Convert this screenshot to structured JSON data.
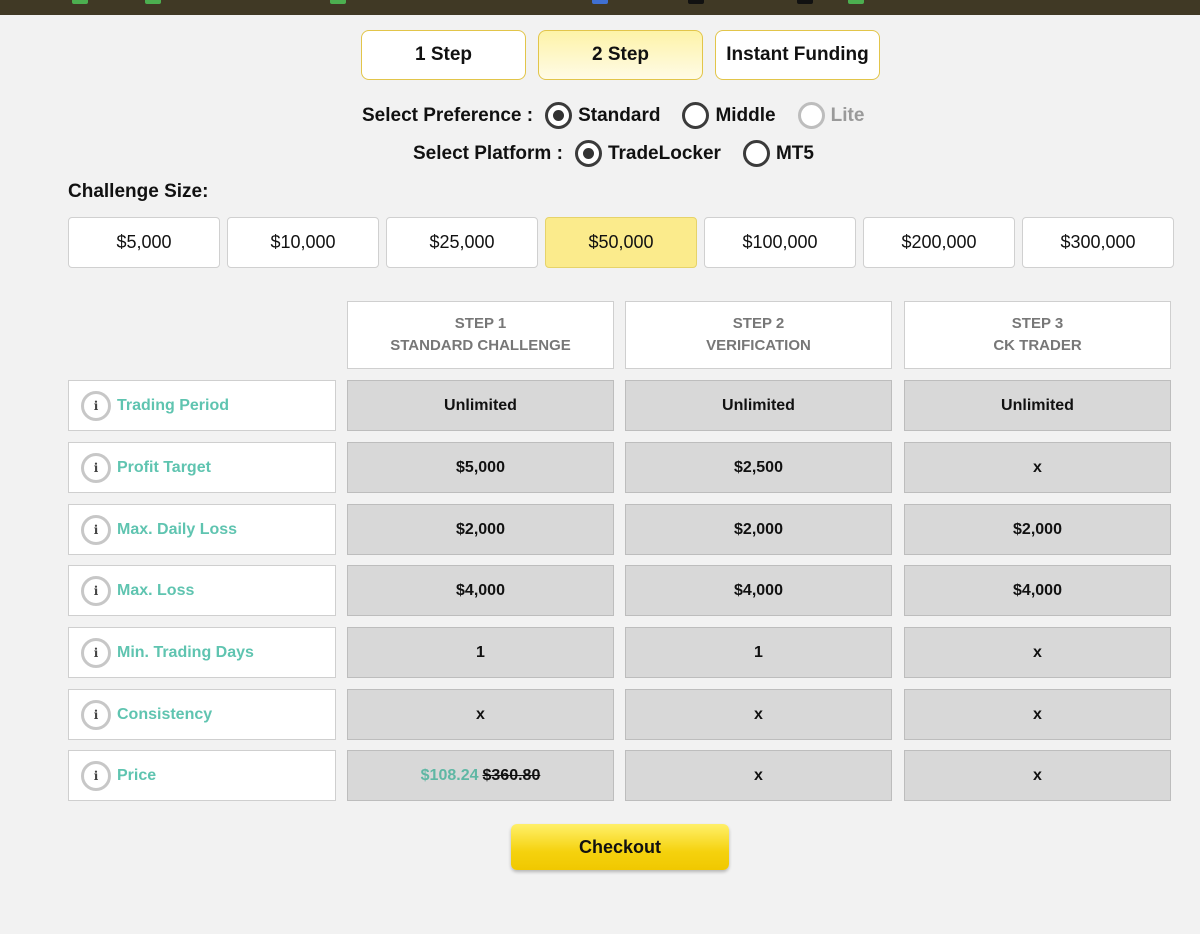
{
  "colors": {
    "accent": "#fbeb8c",
    "label": "#5fc4b0",
    "topbar": "#403925"
  },
  "tabs": [
    {
      "label": "1 Step",
      "active": false
    },
    {
      "label": "2 Step",
      "active": true
    },
    {
      "label": "Instant Funding",
      "active": false
    }
  ],
  "preference": {
    "label": "Select Preference :",
    "options": [
      {
        "label": "Standard",
        "selected": true,
        "disabled": false
      },
      {
        "label": "Middle",
        "selected": false,
        "disabled": false
      },
      {
        "label": "Lite",
        "selected": false,
        "disabled": true
      }
    ]
  },
  "platform": {
    "label": "Select Platform :",
    "options": [
      {
        "label": "TradeLocker",
        "selected": true
      },
      {
        "label": "MT5",
        "selected": false
      }
    ]
  },
  "challenge_size": {
    "label": "Challenge Size:",
    "options": [
      "$5,000",
      "$10,000",
      "$25,000",
      "$50,000",
      "$100,000",
      "$200,000",
      "$300,000"
    ],
    "selected": "$50,000"
  },
  "table": {
    "steps": [
      {
        "line1": "STEP 1",
        "line2": "STANDARD CHALLENGE"
      },
      {
        "line1": "STEP 2",
        "line2": "VERIFICATION"
      },
      {
        "line1": "STEP 3",
        "line2": "CK TRADER"
      }
    ],
    "info_glyph": "i",
    "rows": [
      {
        "label": "Trading Period",
        "values": [
          "Unlimited",
          "Unlimited",
          "Unlimited"
        ]
      },
      {
        "label": "Profit Target",
        "values": [
          "$5,000",
          "$2,500",
          "x"
        ]
      },
      {
        "label": "Max. Daily Loss",
        "values": [
          "$2,000",
          "$2,000",
          "$2,000"
        ]
      },
      {
        "label": "Max. Loss",
        "values": [
          "$4,000",
          "$4,000",
          "$4,000"
        ]
      },
      {
        "label": "Min. Trading Days",
        "values": [
          "1",
          "1",
          "x"
        ]
      },
      {
        "label": "Consistency",
        "values": [
          "x",
          "x",
          "x"
        ]
      },
      {
        "label": "Price",
        "values": [
          "",
          "x",
          "x"
        ]
      }
    ],
    "price": {
      "discounted": "$108.24",
      "original": "$360.80"
    }
  },
  "checkout_label": "Checkout"
}
